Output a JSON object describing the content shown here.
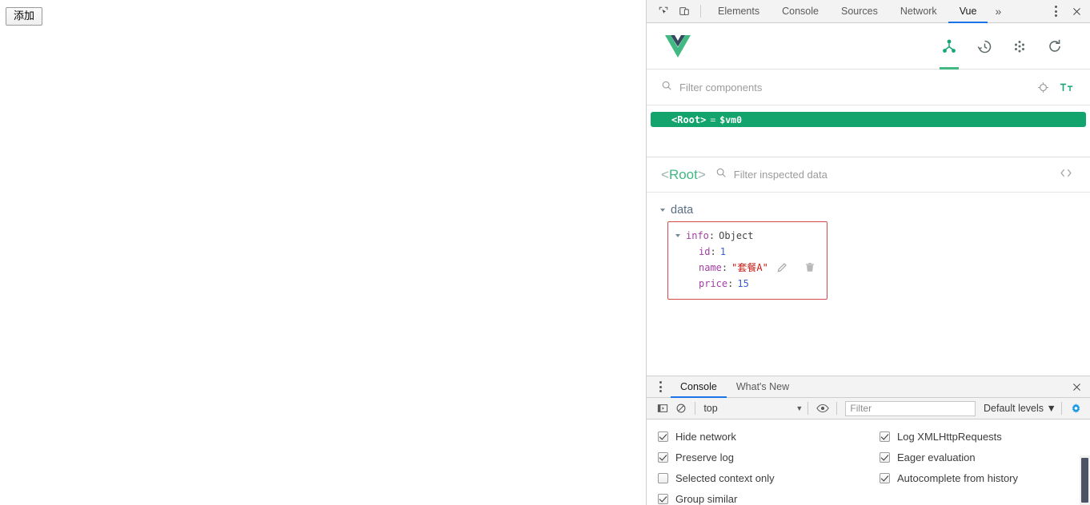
{
  "page": {
    "add_button_label": "添加"
  },
  "devtools": {
    "toolbar": {
      "inspect_icon": "inspect-cursor-icon",
      "device_icon": "device-toolbar-icon",
      "tabs": [
        {
          "label": "Elements",
          "active": false
        },
        {
          "label": "Console",
          "active": false
        },
        {
          "label": "Sources",
          "active": false
        },
        {
          "label": "Network",
          "active": false
        },
        {
          "label": "Vue",
          "active": true
        }
      ],
      "more_tabs_label": "»",
      "menu_icon": "kebab-menu-icon",
      "close_icon": "close-icon"
    },
    "vue_panel": {
      "logo": "vue-logo",
      "actions": [
        {
          "name": "components-tab-icon",
          "active": true
        },
        {
          "name": "timeline-tab-icon",
          "active": false
        },
        {
          "name": "vuex-tab-icon",
          "active": false
        },
        {
          "name": "refresh-icon",
          "active": false
        }
      ],
      "filter": {
        "placeholder": "Filter components",
        "value": "",
        "select_icon": "target-select-icon",
        "text_size_icon": "text-size-icon"
      },
      "tree": {
        "rows": [
          {
            "tag": "<Root>",
            "equals": "=",
            "instance": "$vm0",
            "selected": true
          }
        ]
      },
      "inspector": {
        "root_open": "<",
        "root_name": "Root",
        "root_close": ">",
        "filter_placeholder": "Filter inspected data",
        "filter_value": "",
        "code_icon": "code-brackets-icon"
      },
      "data_section": {
        "title": "data",
        "object": {
          "head_key": "info",
          "head_colon": ":",
          "head_type": "Object",
          "props": [
            {
              "key": "id",
              "colon": ":",
              "value": "1",
              "kind": "number"
            },
            {
              "key": "name",
              "colon": ":",
              "value": "\"套餐A\"",
              "kind": "string",
              "edit_icon": "pencil-edit-icon",
              "delete_icon": "trash-delete-icon"
            },
            {
              "key": "price",
              "colon": ":",
              "value": "15",
              "kind": "number"
            }
          ]
        }
      }
    },
    "drawer": {
      "menu_icon": "kebab-menu-icon",
      "tabs": [
        {
          "label": "Console",
          "active": true
        },
        {
          "label": "What's New",
          "active": false
        }
      ],
      "close_icon": "close-icon",
      "console_toolbar": {
        "sidebar_icon": "console-sidebar-icon",
        "clear_icon": "clear-console-icon",
        "context": "top",
        "context_arrow": "▼",
        "eye_icon": "live-expression-eye-icon",
        "filter_placeholder": "Filter",
        "filter_value": "",
        "levels_label": "Default levels",
        "levels_arrow": "▼",
        "settings_icon": "settings-gear-icon"
      },
      "settings": [
        {
          "label": "Hide network",
          "checked": true
        },
        {
          "label": "Log XMLHttpRequests",
          "checked": true
        },
        {
          "label": "Preserve log",
          "checked": true
        },
        {
          "label": "Eager evaluation",
          "checked": true
        },
        {
          "label": "Selected context only",
          "checked": false
        },
        {
          "label": "Autocomplete from history",
          "checked": true
        },
        {
          "label": "Group similar",
          "checked": true
        },
        {
          "label": "",
          "checked": null
        }
      ]
    }
  },
  "colors": {
    "vue_green": "#42b883",
    "selection_green": "#13a36c",
    "tab_active_blue": "#1a73e8",
    "object_border_red": "#d84b4b",
    "string_red": "#c41a16",
    "key_purple": "#a33ea3",
    "number_blue": "#3a5fcd",
    "gear_blue": "#1a9ae6"
  }
}
